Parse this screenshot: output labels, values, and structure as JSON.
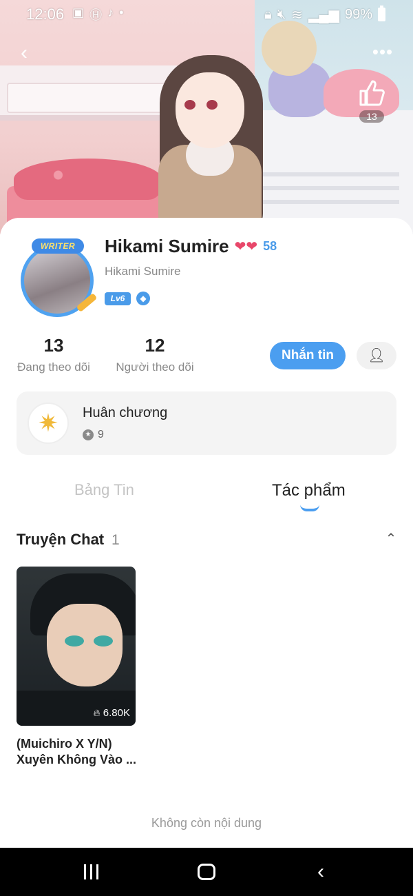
{
  "status_bar": {
    "time": "12:06",
    "battery": "99%",
    "left_icons": [
      "gallery-icon",
      "h-app-icon",
      "tiktok-icon",
      "dot-icon"
    ],
    "right_icons": [
      "lock-icon",
      "mute-icon",
      "wifi-icon",
      "signal-icon",
      "battery-icon"
    ]
  },
  "header": {
    "like_count": "13"
  },
  "profile": {
    "name": "Hikami Sumire",
    "heart_count": "58",
    "handle": "Hikami Sumire",
    "level": "Lv6",
    "avatar_badge": "WRITER",
    "following_count": "13",
    "following_label": "Đang theo dõi",
    "followers_count": "12",
    "followers_label": "Người theo dõi",
    "message_button": "Nhắn tin"
  },
  "medals": {
    "title": "Huân chương",
    "count": "9"
  },
  "tabs": [
    {
      "label": "Bảng Tin",
      "active": false
    },
    {
      "label": "Tác phẩm",
      "active": true
    }
  ],
  "section": {
    "title": "Truyện Chat",
    "count": "1"
  },
  "stories": [
    {
      "title_line1": "(Muichiro X Y/N)",
      "title_line2": "Xuyên Không Vào ...",
      "views": "6.80K"
    }
  ],
  "end_text": "Không còn nội dung",
  "colors": {
    "accent": "#4b9ef0",
    "heart": "#e8476a",
    "muted_text": "#8a8a8a"
  }
}
